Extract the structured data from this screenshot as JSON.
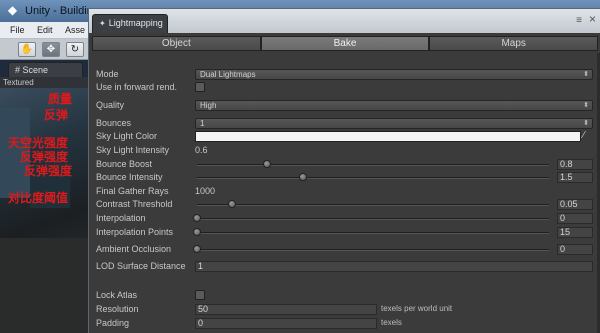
{
  "app": {
    "title": "Unity - Buildin",
    "menu": [
      "File",
      "Edit",
      "Asse"
    ],
    "scene_tab": "Scene",
    "scene_mode": "Textured"
  },
  "annotations": [
    "质量",
    "反弹",
    "天空光强度",
    "反弹强度",
    "反弹强度",
    "对比度阈值"
  ],
  "lightmapping": {
    "window_title": "Lightmapping",
    "tabs": [
      {
        "label": "Object",
        "selected": false
      },
      {
        "label": "Bake",
        "selected": true
      },
      {
        "label": "Maps",
        "selected": false
      }
    ],
    "mode": {
      "label": "Mode",
      "value": "Dual Lightmaps"
    },
    "forward": {
      "label": "Use in forward rend.",
      "checked": false
    },
    "quality": {
      "label": "Quality",
      "value": "High"
    },
    "bounces": {
      "label": "Bounces",
      "value": "1"
    },
    "sky_color": {
      "label": "Sky Light Color",
      "color": "#f6f6f6"
    },
    "sky_intensity": {
      "label": "Sky Light Intensity",
      "value": "0.6"
    },
    "bounce_boost": {
      "label": "Bounce Boost",
      "value": "0.8",
      "fraction": 0.2
    },
    "bounce_intensity": {
      "label": "Bounce Intensity",
      "value": "1.5",
      "fraction": 0.3
    },
    "final_gather": {
      "label": "Final Gather Rays",
      "value": "1000"
    },
    "contrast": {
      "label": "Contrast Threshold",
      "value": "0.05",
      "fraction": 0.1
    },
    "interpolation": {
      "label": "Interpolation",
      "value": "0",
      "fraction": 0.0
    },
    "interp_points": {
      "label": "Interpolation Points",
      "value": "15",
      "fraction": 0.0
    },
    "ao": {
      "label": "Ambient Occlusion",
      "value": "0",
      "fraction": 0.0
    },
    "lod": {
      "label": "LOD Surface Distance",
      "value": "1"
    },
    "lock_atlas": {
      "label": "Lock Atlas",
      "checked": false
    },
    "resolution": {
      "label": "Resolution",
      "value": "50",
      "unit": "texels per world unit"
    },
    "padding": {
      "label": "Padding",
      "value": "0",
      "unit": "texels"
    }
  }
}
